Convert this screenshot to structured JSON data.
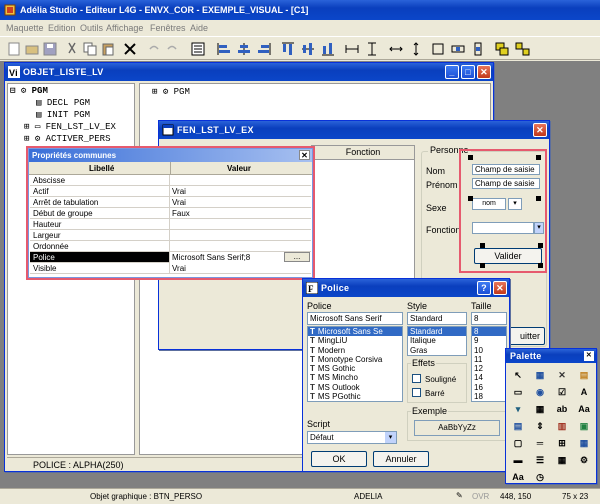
{
  "app": {
    "title": "Adélia Studio - Editeur L4G - ENVX_COR - EXEMPLE_VISUAL - [C1]"
  },
  "menu": [
    "Maquette",
    "Edition",
    "Outils",
    "Affichage",
    "Fenêtres",
    "Aide"
  ],
  "toolbar": {
    "icons": [
      "new-icon",
      "open-icon",
      "save-icon",
      "cut-icon",
      "copy-icon",
      "paste-icon",
      "delete-icon",
      "undo-icon",
      "redo-icon",
      "properties-icon",
      "align-left-icon",
      "align-center-icon",
      "align-right-icon",
      "align-top-icon",
      "align-middle-icon",
      "align-bottom-icon",
      "space-horizontal-icon",
      "space-vertical-icon",
      "same-width-icon",
      "same-height-icon",
      "same-size-icon",
      "center-horizontal-icon",
      "center-vertical-icon",
      "group-icon",
      "ungroup-icon"
    ]
  },
  "objet_window": {
    "title": "OBJET_LISTE_LV",
    "tree": [
      {
        "label": "PGM",
        "bold": true
      },
      {
        "label": "DECL PGM"
      },
      {
        "label": "INIT PGM"
      },
      {
        "label": "FEN_LST_LV_EX"
      },
      {
        "label": "ACTIVER_PERS"
      }
    ],
    "right_tree": "PGM",
    "status": "POLICE : ALPHA(250)"
  },
  "fen_window": {
    "title": "FEN_LST_LV_EX",
    "column_header": "Fonction",
    "group_label": "Personne",
    "labels": {
      "nom": "Nom",
      "prenom": "Prénom",
      "sexe": "Sexe",
      "fonction": "Fonction"
    },
    "field1": "Champ de saisie",
    "field2": "Champ de saisie",
    "combo_value": "nom",
    "validate": "Valider",
    "quit": "uitter"
  },
  "props": {
    "title": "Propriétés communes",
    "headers": {
      "label": "Libellé",
      "value": "Valeur"
    },
    "rows": [
      {
        "label": "Abscisse",
        "value": ""
      },
      {
        "label": "Actif",
        "value": "Vrai"
      },
      {
        "label": "Arrêt de tabulation",
        "value": "Vrai"
      },
      {
        "label": "Début de groupe",
        "value": "Faux"
      },
      {
        "label": "Hauteur",
        "value": ""
      },
      {
        "label": "Largeur",
        "value": ""
      },
      {
        "label": "Ordonnée",
        "value": ""
      },
      {
        "label": "Police",
        "value": "Microsoft Sans Serif;8",
        "selected": true,
        "button": "..."
      },
      {
        "label": "Visible",
        "value": "Vrai"
      }
    ]
  },
  "police": {
    "title": "Police",
    "labels": {
      "police": "Police",
      "style": "Style",
      "taille": "Taille",
      "effets": "Effets",
      "exemple": "Exemple",
      "script": "Script"
    },
    "font_value": "Microsoft Sans Serif",
    "fonts": [
      "Microsoft Sans Se",
      "MingLiU",
      "Modern",
      "Monotype Corsiva",
      "MS Gothic",
      "MS Mincho",
      "MS Outlook",
      "MS PGothic"
    ],
    "style_value": "Standard",
    "styles": [
      "Standard",
      "Italique",
      "Gras"
    ],
    "size_value": "8",
    "sizes": [
      "8",
      "9",
      "10",
      "11",
      "12",
      "14",
      "16",
      "18"
    ],
    "effects": [
      "Souligné",
      "Barré"
    ],
    "sample": "AaBbYyZz",
    "script_value": "Défaut",
    "ok": "OK",
    "cancel": "Annuler"
  },
  "palette": {
    "title": "Palette"
  },
  "statusbar": {
    "object": "Objet graphique : BTN_PERSO",
    "user": "ADELIA",
    "mode": "OVR",
    "position": "448, 150",
    "size": "75 x 23"
  },
  "colors": {
    "titlebar": "#0a3fbd",
    "highlight": "#e65a6e",
    "selection": "#316ac5"
  }
}
